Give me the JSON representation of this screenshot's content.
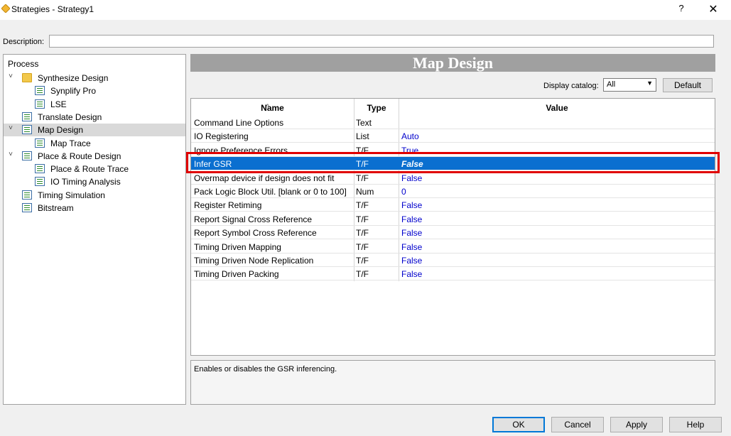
{
  "window": {
    "title": "Strategies - Strategy1",
    "help_label": "?",
    "close_label": "✕"
  },
  "description": {
    "label": "Description:",
    "value": ""
  },
  "tree": {
    "header": "Process",
    "items": [
      {
        "label": "Synthesize Design",
        "icon": "folder-icon",
        "expander": "expanded",
        "level": 0
      },
      {
        "label": "Synplify Pro",
        "icon": "checklist-icon",
        "level": 1
      },
      {
        "label": "LSE",
        "icon": "checklist-icon",
        "level": 1
      },
      {
        "label": "Translate Design",
        "icon": "checklist-icon",
        "level": 0
      },
      {
        "label": "Map Design",
        "icon": "checklist-icon",
        "expander": "expanded",
        "level": 0,
        "selected": true
      },
      {
        "label": "Map Trace",
        "icon": "checklist-icon",
        "level": 1
      },
      {
        "label": "Place & Route Design",
        "icon": "checklist-icon",
        "expander": "expanded",
        "level": 0
      },
      {
        "label": "Place & Route Trace",
        "icon": "checklist-icon",
        "level": 1
      },
      {
        "label": "IO Timing Analysis",
        "icon": "checklist-icon",
        "level": 1
      },
      {
        "label": "Timing Simulation",
        "icon": "checklist-icon",
        "level": 0
      },
      {
        "label": "Bitstream",
        "icon": "checklist-icon",
        "level": 0
      }
    ]
  },
  "main": {
    "heading": "Map Design",
    "catalog_label": "Display catalog:",
    "catalog_value": "All",
    "default_button": "Default",
    "columns": {
      "name": "Name",
      "type": "Type",
      "value": "Value"
    },
    "rows": [
      {
        "name": "Command Line Options",
        "type": "Text",
        "value": ""
      },
      {
        "name": "IO Registering",
        "type": "List",
        "value": "Auto"
      },
      {
        "name": "Ignore Preference Errors",
        "type": "T/F",
        "value": "True"
      },
      {
        "name": "Infer GSR",
        "type": "T/F",
        "value": "False",
        "selected": true
      },
      {
        "name": "Overmap device if design does not fit",
        "type": "T/F",
        "value": "False"
      },
      {
        "name": "Pack Logic Block Util. [blank or 0 to 100]",
        "type": "Num",
        "value": "0"
      },
      {
        "name": "Register Retiming",
        "type": "T/F",
        "value": "False"
      },
      {
        "name": "Report Signal Cross Reference",
        "type": "T/F",
        "value": "False"
      },
      {
        "name": "Report Symbol Cross Reference",
        "type": "T/F",
        "value": "False"
      },
      {
        "name": "Timing Driven Mapping",
        "type": "T/F",
        "value": "False"
      },
      {
        "name": "Timing Driven Node Replication",
        "type": "T/F",
        "value": "False"
      },
      {
        "name": "Timing Driven Packing",
        "type": "T/F",
        "value": "False"
      }
    ],
    "description_text": "Enables or disables the GSR inferencing."
  },
  "buttons": {
    "ok": "OK",
    "cancel": "Cancel",
    "apply": "Apply",
    "help": "Help"
  },
  "colors": {
    "selection": "#0a6fd0",
    "value_text": "#0000cc",
    "highlight_box": "#e00000",
    "heading_bar": "#a0a0a0"
  }
}
